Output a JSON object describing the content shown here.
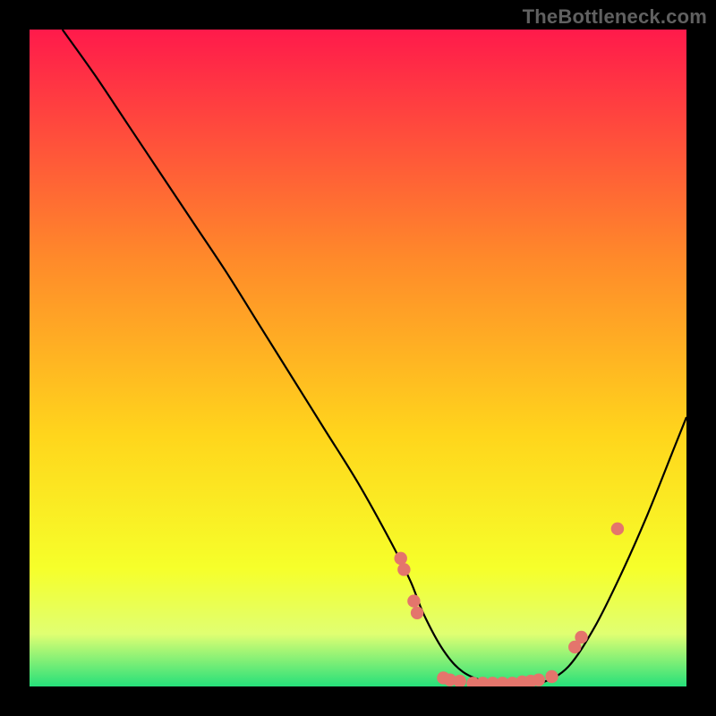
{
  "watermark": "TheBottleneck.com",
  "colors": {
    "marker": "#e4756c",
    "line": "#000000",
    "grad_top": "#ff1a4b",
    "grad_mid1": "#ff6a3a",
    "grad_mid2": "#ffd61c",
    "grad_mid3": "#f6ff2a",
    "grad_band": "#e0ff72",
    "grad_bottom": "#26e07a"
  },
  "chart_data": {
    "type": "line",
    "title": "",
    "xlabel": "",
    "ylabel": "",
    "xlim": [
      0,
      100
    ],
    "ylim": [
      0,
      100
    ],
    "series": [
      {
        "name": "curve",
        "x": [
          5,
          10,
          15,
          20,
          25,
          30,
          35,
          40,
          45,
          50,
          55,
          58,
          60,
          63,
          66,
          70,
          74,
          78,
          82,
          86,
          90,
          94,
          98,
          100
        ],
        "y": [
          100,
          93,
          85.5,
          78,
          70.5,
          63,
          55,
          47,
          39,
          31,
          22,
          16,
          11,
          5.5,
          2.2,
          0.6,
          0.3,
          0.6,
          3,
          9,
          17,
          26,
          36,
          41
        ]
      }
    ],
    "markers": [
      {
        "x": 56.5,
        "y": 19.5
      },
      {
        "x": 57.0,
        "y": 17.8
      },
      {
        "x": 58.5,
        "y": 13.0
      },
      {
        "x": 59.0,
        "y": 11.2
      },
      {
        "x": 63.0,
        "y": 1.3
      },
      {
        "x": 64.0,
        "y": 1.0
      },
      {
        "x": 65.5,
        "y": 0.8
      },
      {
        "x": 67.5,
        "y": 0.5
      },
      {
        "x": 69.0,
        "y": 0.5
      },
      {
        "x": 70.5,
        "y": 0.5
      },
      {
        "x": 72.0,
        "y": 0.5
      },
      {
        "x": 73.5,
        "y": 0.5
      },
      {
        "x": 75.0,
        "y": 0.7
      },
      {
        "x": 76.3,
        "y": 0.8
      },
      {
        "x": 77.5,
        "y": 1.0
      },
      {
        "x": 79.5,
        "y": 1.5
      },
      {
        "x": 83.0,
        "y": 6.0
      },
      {
        "x": 84.0,
        "y": 7.5
      },
      {
        "x": 89.5,
        "y": 24.0
      }
    ]
  }
}
